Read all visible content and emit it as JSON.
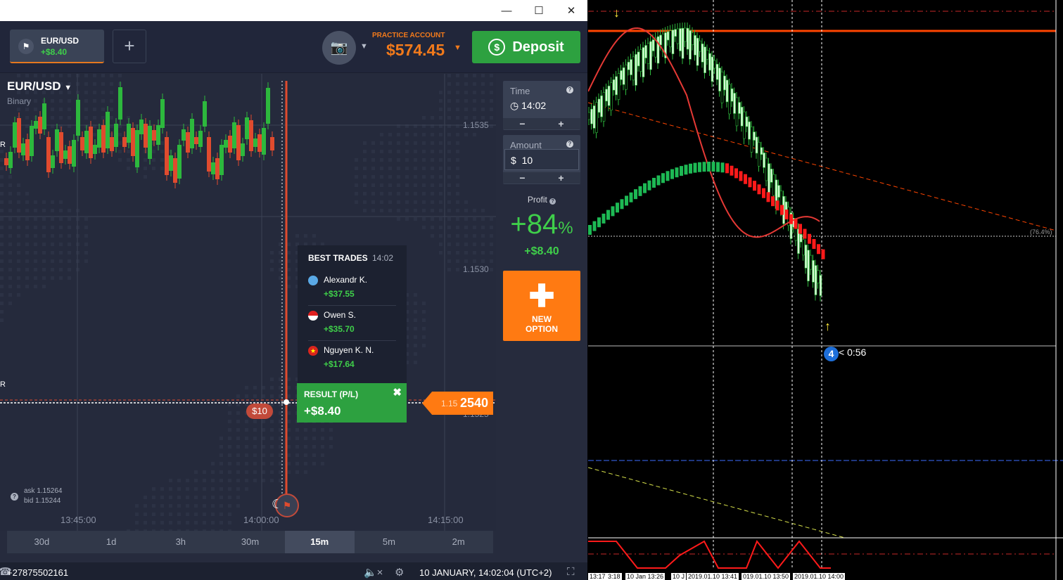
{
  "window": {
    "min_icon": "minimize-icon",
    "max_icon": "maximize-icon",
    "close_icon": "close-icon"
  },
  "topbar": {
    "asset_tab": {
      "name": "EUR/USD",
      "pl": "+$8.40",
      "icon": "flag-icon"
    },
    "add_tab_label": "+",
    "camera_icon": "camera-icon",
    "account_label": "PRACTICE ACCOUNT",
    "account_balance": "$574.45",
    "deposit_label": "Deposit"
  },
  "asset": {
    "title": "EUR/USD",
    "subtitle": "Binary"
  },
  "chart": {
    "y_ticks": [
      "1.1535",
      "1.1530",
      "1.1525"
    ],
    "x_ticks": [
      "13:45:00",
      "14:00:00",
      "14:15:00"
    ],
    "side_labels": [
      "R",
      "R"
    ],
    "ask": "ask 1.15264",
    "bid": "bid 1.15244",
    "bet_label": "$10",
    "price_small": "1.15",
    "price_big": "2540"
  },
  "controls": {
    "time_label": "Time",
    "time_value": "14:02",
    "amount_label": "Amount",
    "amount_value": "$  10",
    "minus": "−",
    "plus": "+",
    "profit_label": "Profit",
    "profit_pct": "+84",
    "profit_pct_sign": "%",
    "profit_amt": "+$8.40",
    "new_option": "NEW OPTION"
  },
  "best_trades": {
    "title": "BEST TRADES",
    "time": "14:02",
    "traders": [
      {
        "name": "Alexandr K.",
        "profit": "+$37.55",
        "flag_color": "#5aa9e6"
      },
      {
        "name": "Owen S.",
        "profit": "+$35.70",
        "flag_color": "#ffffff"
      },
      {
        "name": "Nguyen K. N.",
        "profit": "+$17.64",
        "flag_color": "#da251d"
      }
    ]
  },
  "result": {
    "label": "RESULT (P/L)",
    "value": "+$8.40",
    "close": "✖"
  },
  "timeframes": [
    {
      "label": "30d",
      "active": false
    },
    {
      "label": "1d",
      "active": false
    },
    {
      "label": "3h",
      "active": false
    },
    {
      "label": "30m",
      "active": false
    },
    {
      "label": "15m",
      "active": true
    },
    {
      "label": "5m",
      "active": false
    },
    {
      "label": "2m",
      "active": false
    }
  ],
  "status": {
    "phone": "+27875502161",
    "datetime": "10 JANUARY, 14:02:04  (UTC+2)"
  },
  "mt4": {
    "timer_num": "4",
    "timer": "< 0:56",
    "pct": "(76.4%)",
    "bottom_times": [
      "13:17",
      "3:18",
      "10 Jan 13:26",
      "10 J",
      "2019.01.10 13:41",
      "019.01.10 13:50",
      "2019.01.10 14:00"
    ]
  },
  "colors": {
    "up": "#2db83d",
    "down": "#e04b2e",
    "accent": "#ff7a12",
    "green_btn": "#2da140",
    "bg": "#262b3d"
  }
}
